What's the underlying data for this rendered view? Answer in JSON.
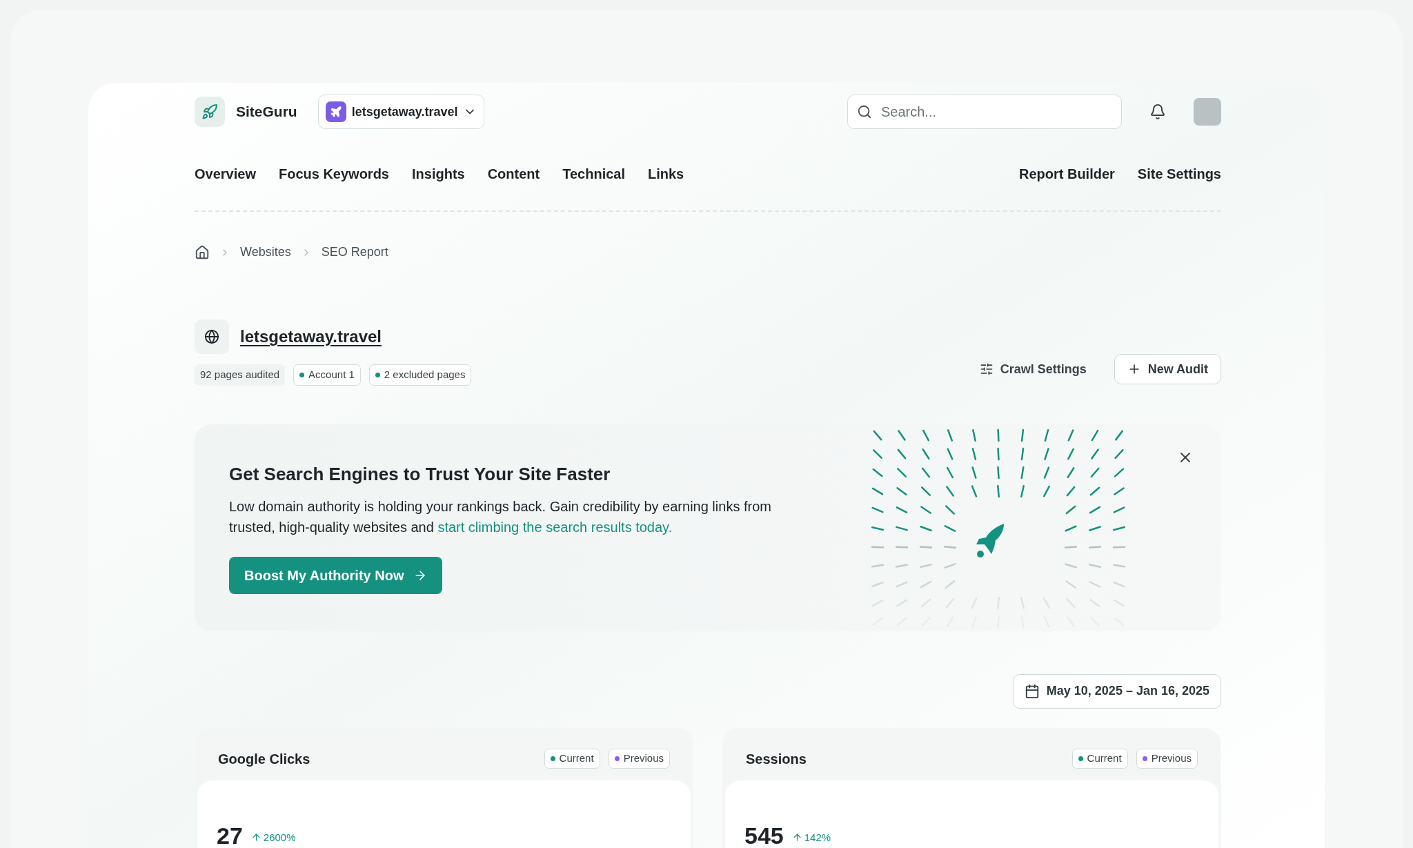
{
  "brand": {
    "name": "SiteGuru"
  },
  "site_switcher": {
    "label": "letsgetaway.travel"
  },
  "search": {
    "placeholder": "Search..."
  },
  "nav": {
    "primary": [
      "Overview",
      "Focus Keywords",
      "Insights",
      "Content",
      "Technical",
      "Links"
    ],
    "secondary": [
      "Report Builder",
      "Site Settings"
    ]
  },
  "breadcrumb": [
    "Websites",
    "SEO Report"
  ],
  "site": {
    "title": "letsgetaway.travel",
    "tags": [
      {
        "label": "92 pages audited",
        "kind": "plain"
      },
      {
        "label": "Account 1",
        "kind": "dot"
      },
      {
        "label": "2 excluded pages",
        "kind": "dot"
      }
    ]
  },
  "actions": [
    {
      "label": "Crawl Settings",
      "kind": "ghost"
    },
    {
      "label": "New Audit",
      "kind": "outlined"
    }
  ],
  "banner": {
    "title": "Get Search Engines to Trust Your Site Faster",
    "body": "Low domain authority is holding your rankings back. Gain credibility by earning links from trusted, high-quality websites and",
    "link": "start climbing the search results today.",
    "button": "Boost My Authority Now"
  },
  "date_range": "May 10, 2025 – Jan 16, 2025",
  "metrics": [
    {
      "title": "Google Clicks",
      "legend": [
        {
          "label": "Current",
          "color": "#14917f"
        },
        {
          "label": "Previous",
          "color": "#8b5cf6"
        }
      ],
      "value": "27",
      "change": "2600%"
    },
    {
      "title": "Sessions",
      "legend": [
        {
          "label": "Current",
          "color": "#14917f"
        },
        {
          "label": "Previous",
          "color": "#8b5cf6"
        }
      ],
      "value": "545",
      "change": "142%"
    }
  ]
}
